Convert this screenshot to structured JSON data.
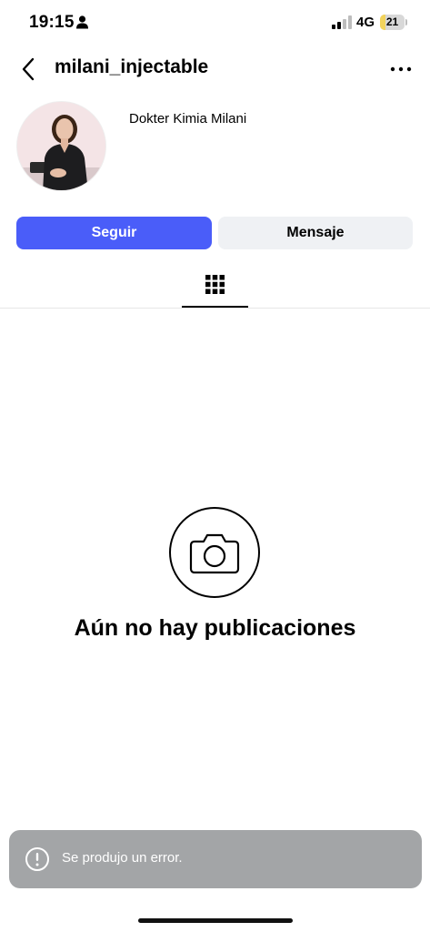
{
  "status_bar": {
    "time": "19:15",
    "network": "4G",
    "battery": {
      "percent_label": "21",
      "level": 0.21
    },
    "icons": [
      "person-icon",
      "signal-icon",
      "battery-icon"
    ]
  },
  "header": {
    "username": "milani_injectable",
    "back_icon": "chevron-left-icon",
    "more_icon": "more-horizontal-icon"
  },
  "profile": {
    "display_name": "Dokter Kimia Milani",
    "avatar_icon": "profile-photo"
  },
  "actions": {
    "follow_label": "Seguir",
    "message_label": "Mensaje"
  },
  "tabs": {
    "active": "grid",
    "grid_icon": "grid-icon"
  },
  "empty_state": {
    "icon": "camera-icon",
    "title": "Aún no hay publicaciones"
  },
  "toast": {
    "icon": "alert-circle-icon",
    "message": "Se produjo un error."
  },
  "colors": {
    "primary_button": "#4a5df9",
    "secondary_button": "#eff1f4",
    "toast_background": "#a3a5a7",
    "battery_fill": "#f2d35c",
    "avatar_background": "#f4e4e6"
  }
}
